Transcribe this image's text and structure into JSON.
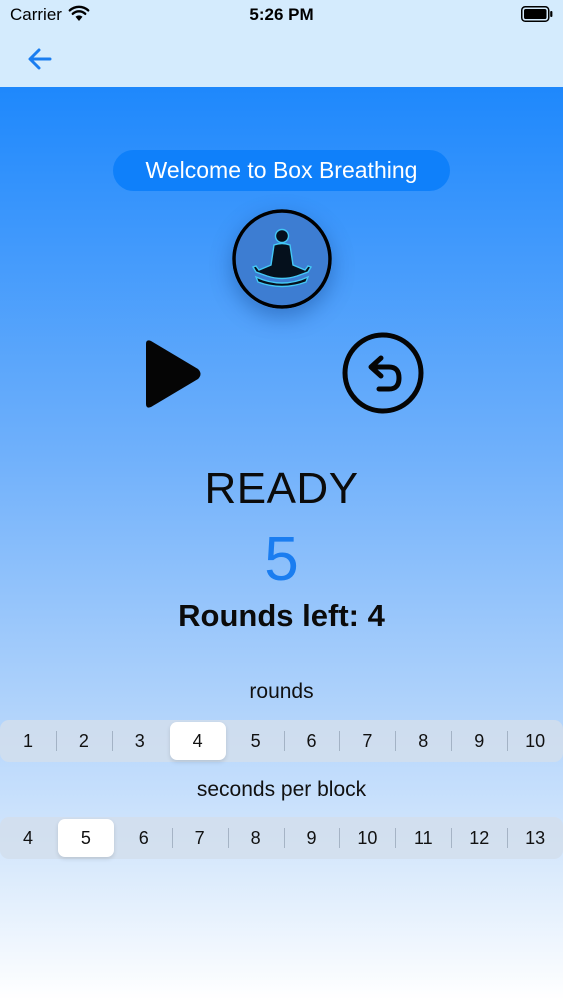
{
  "status_bar": {
    "carrier": "Carrier",
    "time": "5:26 PM",
    "icons": [
      "wifi-icon",
      "battery-icon"
    ]
  },
  "nav": {
    "back_icon": "arrow-left-icon",
    "accent_color": "#1a7df0"
  },
  "header": {
    "welcome": "Welcome to Box Breathing",
    "avatar_icon": "meditation-figure-icon"
  },
  "controls": {
    "play_icon": "play-icon",
    "reset_icon": "undo-circle-icon"
  },
  "session": {
    "phase": "READY",
    "count": "5",
    "rounds_left": "Rounds left: 4"
  },
  "rounds_picker": {
    "label": "rounds",
    "options": [
      "1",
      "2",
      "3",
      "4",
      "5",
      "6",
      "7",
      "8",
      "9",
      "10"
    ],
    "selected": "4"
  },
  "seconds_picker": {
    "label": "seconds per block",
    "options": [
      "4",
      "5",
      "6",
      "7",
      "8",
      "9",
      "10",
      "11",
      "12",
      "13"
    ],
    "selected": "5"
  },
  "colors": {
    "gradient_top": "#1e88fc",
    "pill_bg": "#0f80fa",
    "count_color": "#1a7df0"
  }
}
